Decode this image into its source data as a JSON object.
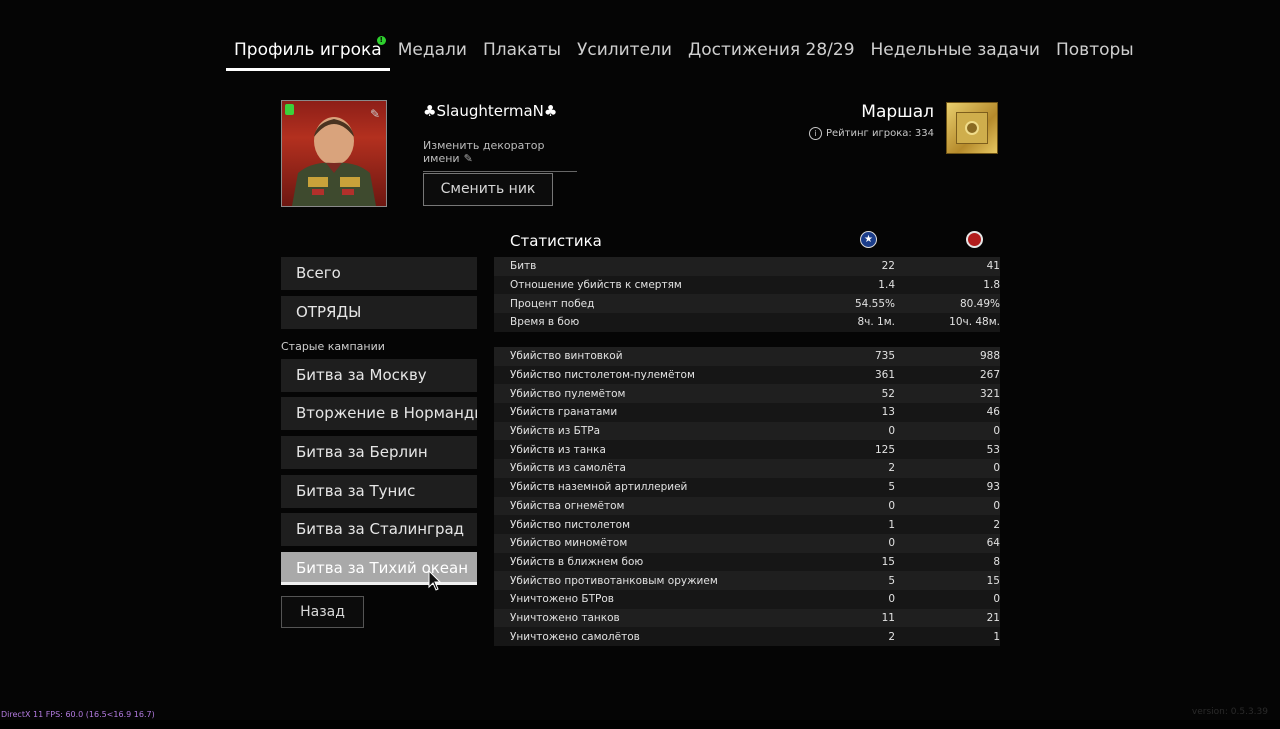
{
  "tabs": [
    {
      "label": "Профиль игрока",
      "active": true,
      "badge": "!"
    },
    {
      "label": "Медали",
      "active": false
    },
    {
      "label": "Плакаты",
      "active": false
    },
    {
      "label": "Усилители",
      "active": false
    },
    {
      "label": "Достижения 28/29",
      "active": false
    },
    {
      "label": "Недельные задачи",
      "active": false
    },
    {
      "label": "Повторы",
      "active": false
    }
  ],
  "profile": {
    "nickname": "♣SlaughtermaN♣",
    "change_decorator": "Изменить декоратор имени",
    "change_nick_button": "Сменить ник",
    "rank_name": "Маршал",
    "rating_text": "Рейтинг игрока: 334"
  },
  "menu": {
    "top_items": [
      "Всего",
      "ОТРЯДЫ"
    ],
    "old_campaigns_label": "Старые кампании",
    "campaigns": [
      "Битва за Москву",
      "Вторжение в Нормандию",
      "Битва за Берлин",
      "Битва за Тунис",
      "Битва за Сталинград",
      "Битва за Тихий океан"
    ],
    "selected": "Битва за Тихий океан",
    "back_button": "Назад"
  },
  "stats": {
    "title": "Статистика",
    "faction_icons": [
      "star-icon",
      "red-circle-icon"
    ],
    "summary": [
      {
        "label": "Битв",
        "v1": "22",
        "v2": "41"
      },
      {
        "label": "Отношение убийств к смертям",
        "v1": "1.4",
        "v2": "1.8"
      },
      {
        "label": "Процент побед",
        "v1": "54.55%",
        "v2": "80.49%"
      },
      {
        "label": "Время в бою",
        "v1": "8ч. 1м.",
        "v2": "10ч. 48м."
      }
    ],
    "details": [
      {
        "label": "Убийство винтовкой",
        "v1": "735",
        "v2": "988"
      },
      {
        "label": "Убийство пистолетом-пулемётом",
        "v1": "361",
        "v2": "267"
      },
      {
        "label": "Убийство пулемётом",
        "v1": "52",
        "v2": "321"
      },
      {
        "label": "Убийств гранатами",
        "v1": "13",
        "v2": "46"
      },
      {
        "label": "Убийств из БТРа",
        "v1": "0",
        "v2": "0"
      },
      {
        "label": "Убийств из танка",
        "v1": "125",
        "v2": "53"
      },
      {
        "label": "Убийств из самолёта",
        "v1": "2",
        "v2": "0"
      },
      {
        "label": "Убийств наземной артиллерией",
        "v1": "5",
        "v2": "93"
      },
      {
        "label": "Убийства огнемётом",
        "v1": "0",
        "v2": "0"
      },
      {
        "label": "Убийство пистолетом",
        "v1": "1",
        "v2": "2"
      },
      {
        "label": "Убийство миномётом",
        "v1": "0",
        "v2": "64"
      },
      {
        "label": "Убийств в ближнем бою",
        "v1": "15",
        "v2": "8"
      },
      {
        "label": "Убийство противотанковым оружием",
        "v1": "5",
        "v2": "15"
      },
      {
        "label": "Уничтожено БТРов",
        "v1": "0",
        "v2": "0"
      },
      {
        "label": "Уничтожено танков",
        "v1": "11",
        "v2": "21"
      },
      {
        "label": "Уничтожено самолётов",
        "v1": "2",
        "v2": "1"
      }
    ]
  },
  "overlay": {
    "fps": "DirectX 11 FPS: 60.0 (16.5<16.9 16.7)",
    "version": "version: 0.5.3.39"
  }
}
